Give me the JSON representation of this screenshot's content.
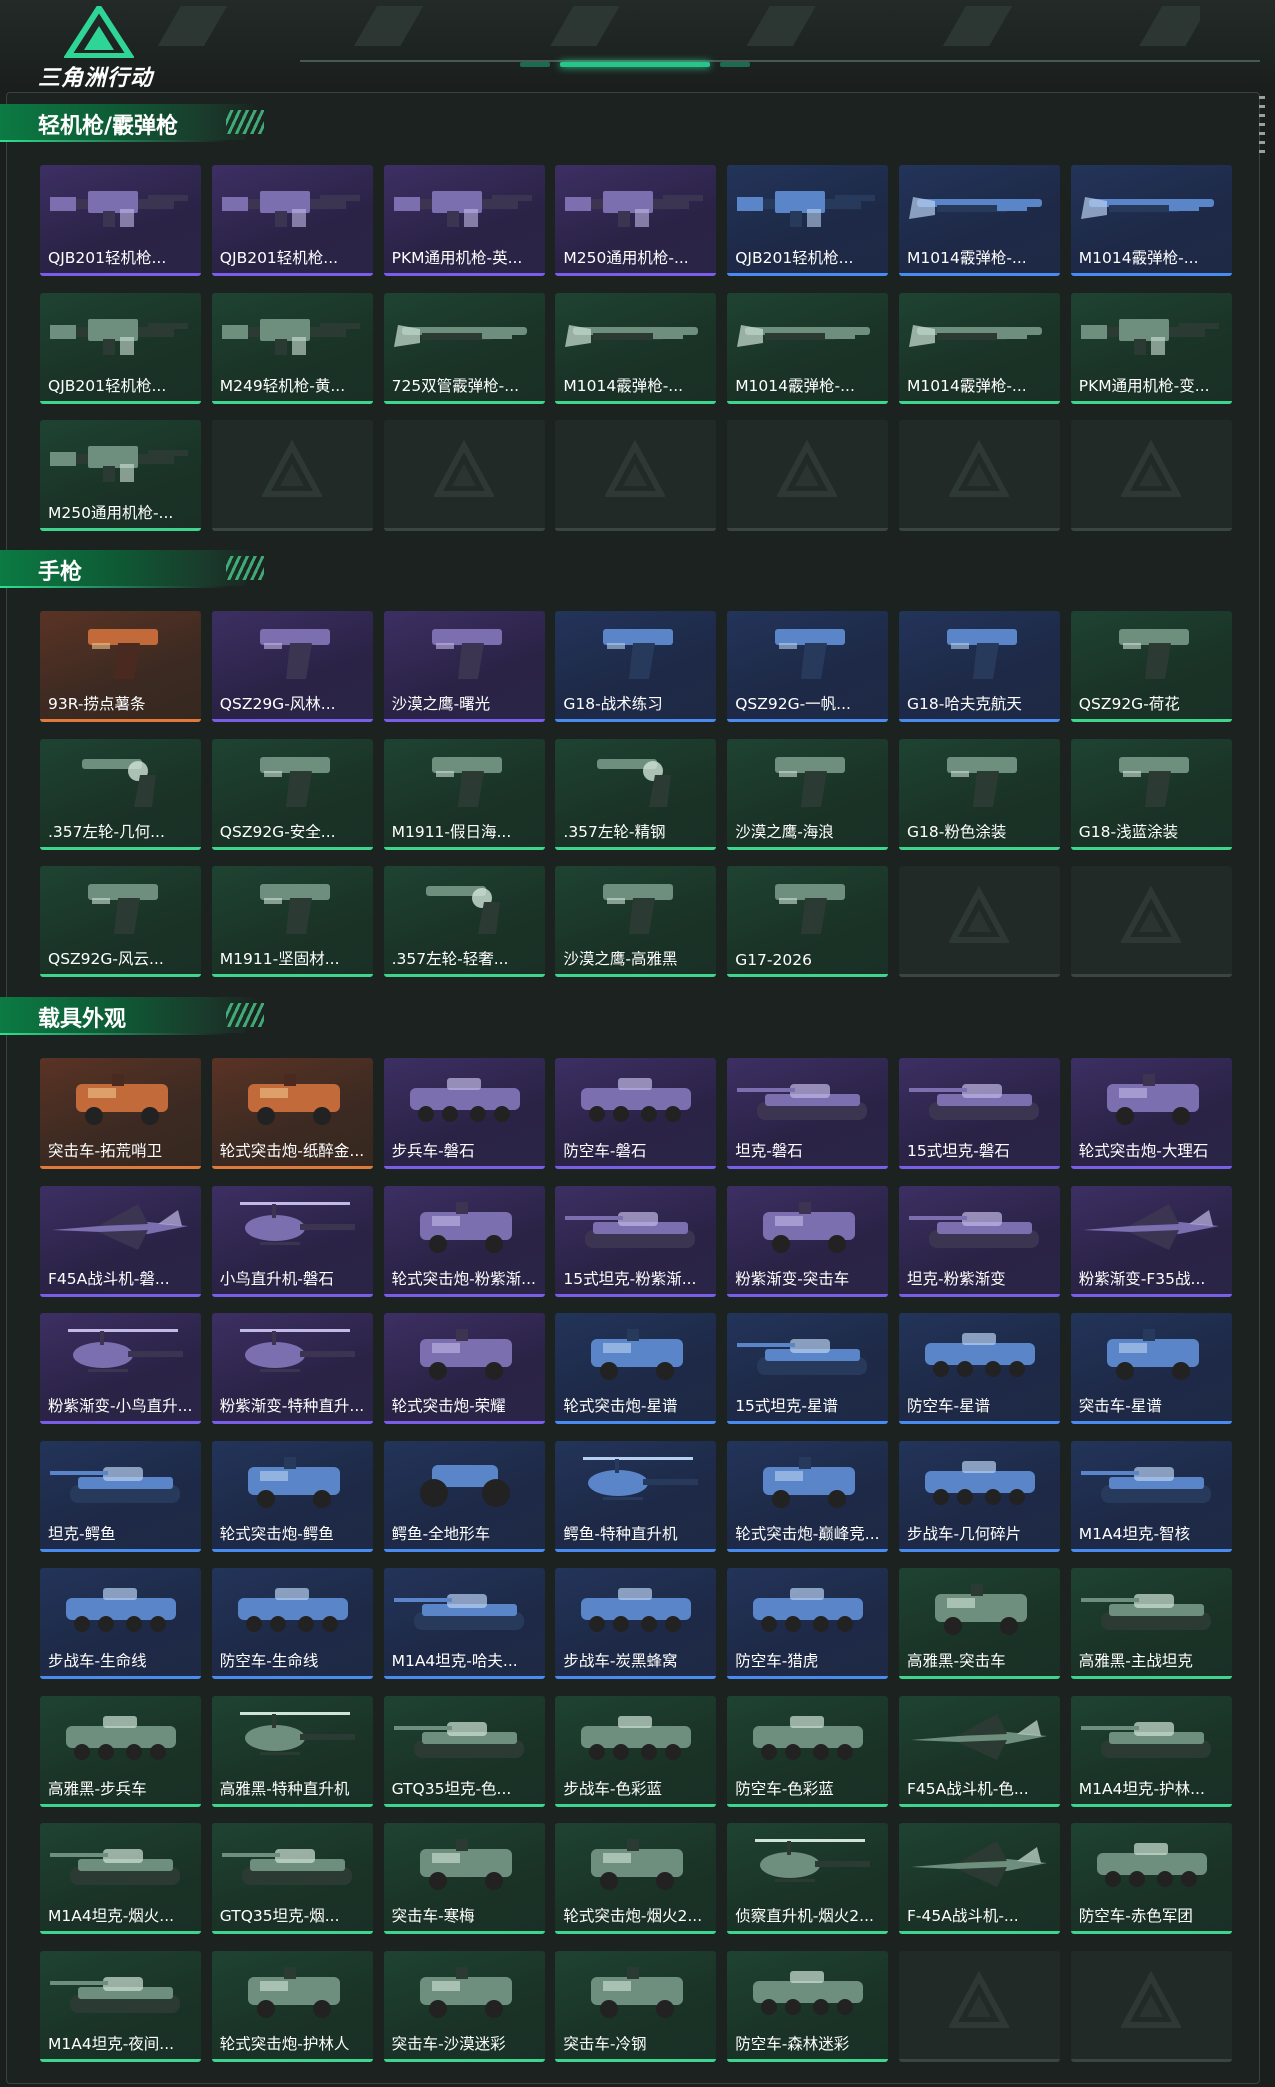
{
  "app": {
    "logo_text": "三角洲行动"
  },
  "sections": [
    {
      "title": "轻机枪/霰弹枪",
      "items": [
        {
          "label": "QJB201轻机枪...",
          "rarity": "purple",
          "icon": "machine-gun-icon"
        },
        {
          "label": "QJB201轻机枪...",
          "rarity": "purple",
          "icon": "machine-gun-icon"
        },
        {
          "label": "PKM通用机枪-英...",
          "rarity": "purple",
          "icon": "machine-gun-icon"
        },
        {
          "label": "M250通用机枪-...",
          "rarity": "purple",
          "icon": "machine-gun-icon"
        },
        {
          "label": "QJB201轻机枪...",
          "rarity": "blue",
          "icon": "machine-gun-icon"
        },
        {
          "label": "M1014霰弹枪-...",
          "rarity": "blue",
          "icon": "shotgun-icon"
        },
        {
          "label": "M1014霰弹枪-...",
          "rarity": "blue",
          "icon": "shotgun-icon"
        },
        {
          "label": "QJB201轻机枪...",
          "rarity": "green",
          "icon": "machine-gun-icon"
        },
        {
          "label": "M249轻机枪-黄...",
          "rarity": "green",
          "icon": "machine-gun-icon"
        },
        {
          "label": "725双管霰弹枪-...",
          "rarity": "green",
          "icon": "shotgun-icon"
        },
        {
          "label": "M1014霰弹枪-...",
          "rarity": "green",
          "icon": "shotgun-icon"
        },
        {
          "label": "M1014霰弹枪-...",
          "rarity": "green",
          "icon": "shotgun-icon"
        },
        {
          "label": "M1014霰弹枪-...",
          "rarity": "green",
          "icon": "shotgun-icon"
        },
        {
          "label": "PKM通用机枪-变...",
          "rarity": "green",
          "icon": "machine-gun-icon"
        },
        {
          "label": "M250通用机枪-...",
          "rarity": "green",
          "icon": "machine-gun-icon"
        },
        {
          "label": "",
          "rarity": "empty"
        },
        {
          "label": "",
          "rarity": "empty"
        },
        {
          "label": "",
          "rarity": "empty"
        },
        {
          "label": "",
          "rarity": "empty"
        },
        {
          "label": "",
          "rarity": "empty"
        },
        {
          "label": "",
          "rarity": "empty"
        }
      ]
    },
    {
      "title": "手枪",
      "items": [
        {
          "label": "93R-捞点薯条",
          "rarity": "orange",
          "icon": "pistol-icon"
        },
        {
          "label": "QSZ29G-风林...",
          "rarity": "purple",
          "icon": "pistol-icon"
        },
        {
          "label": "沙漠之鹰-曙光",
          "rarity": "purple",
          "icon": "pistol-icon"
        },
        {
          "label": "G18-战术练习",
          "rarity": "blue",
          "icon": "pistol-icon"
        },
        {
          "label": "QSZ92G-一帆...",
          "rarity": "blue",
          "icon": "pistol-icon"
        },
        {
          "label": "G18-哈夫克航天",
          "rarity": "blue",
          "icon": "pistol-icon"
        },
        {
          "label": "QSZ92G-荷花",
          "rarity": "green",
          "icon": "pistol-icon"
        },
        {
          "label": ".357左轮-几何...",
          "rarity": "green",
          "icon": "revolver-icon"
        },
        {
          "label": "QSZ92G-安全...",
          "rarity": "green",
          "icon": "pistol-icon"
        },
        {
          "label": "M1911-假日海...",
          "rarity": "green",
          "icon": "pistol-icon"
        },
        {
          "label": ".357左轮-精钢",
          "rarity": "green",
          "icon": "revolver-icon"
        },
        {
          "label": "沙漠之鹰-海浪",
          "rarity": "green",
          "icon": "pistol-icon"
        },
        {
          "label": "G18-粉色涂装",
          "rarity": "green",
          "icon": "pistol-icon"
        },
        {
          "label": "G18-浅蓝涂装",
          "rarity": "green",
          "icon": "pistol-icon"
        },
        {
          "label": "QSZ92G-风云...",
          "rarity": "green",
          "icon": "pistol-icon"
        },
        {
          "label": "M1911-坚固材...",
          "rarity": "green",
          "icon": "pistol-icon"
        },
        {
          "label": ".357左轮-轻奢...",
          "rarity": "green",
          "icon": "revolver-icon"
        },
        {
          "label": "沙漠之鹰-高雅黑",
          "rarity": "green",
          "icon": "pistol-icon"
        },
        {
          "label": "G17-2026",
          "rarity": "green",
          "icon": "pistol-icon"
        },
        {
          "label": "",
          "rarity": "empty"
        },
        {
          "label": "",
          "rarity": "empty"
        }
      ]
    },
    {
      "title": "载具外观",
      "items": [
        {
          "label": "突击车-拓荒哨卫",
          "rarity": "orange",
          "icon": "armored-car-icon"
        },
        {
          "label": "轮式突击炮-纸醉金...",
          "rarity": "orange",
          "icon": "armored-car-icon"
        },
        {
          "label": "步兵车-磐石",
          "rarity": "purple",
          "icon": "ifv-icon"
        },
        {
          "label": "防空车-磐石",
          "rarity": "purple",
          "icon": "ifv-icon"
        },
        {
          "label": "坦克-磐石",
          "rarity": "purple",
          "icon": "tank-icon"
        },
        {
          "label": "15式坦克-磐石",
          "rarity": "purple",
          "icon": "tank-icon"
        },
        {
          "label": "轮式突击炮-大理石",
          "rarity": "purple",
          "icon": "armored-car-icon"
        },
        {
          "label": "F45A战斗机-磐...",
          "rarity": "purple",
          "icon": "jet-icon"
        },
        {
          "label": "小鸟直升机-磐石",
          "rarity": "purple",
          "icon": "helicopter-icon"
        },
        {
          "label": "轮式突击炮-粉紫渐...",
          "rarity": "purple",
          "icon": "armored-car-icon"
        },
        {
          "label": "15式坦克-粉紫渐...",
          "rarity": "purple",
          "icon": "tank-icon"
        },
        {
          "label": "粉紫渐变-突击车",
          "rarity": "purple",
          "icon": "armored-car-icon"
        },
        {
          "label": "坦克-粉紫渐变",
          "rarity": "purple",
          "icon": "tank-icon"
        },
        {
          "label": "粉紫渐变-F35战...",
          "rarity": "purple",
          "icon": "jet-icon"
        },
        {
          "label": "粉紫渐变-小鸟直升...",
          "rarity": "purple",
          "icon": "helicopter-icon"
        },
        {
          "label": "粉紫渐变-特种直升...",
          "rarity": "purple",
          "icon": "helicopter-icon"
        },
        {
          "label": "轮式突击炮-荣耀",
          "rarity": "purple",
          "icon": "armored-car-icon"
        },
        {
          "label": "轮式突击炮-星谱",
          "rarity": "blue",
          "icon": "armored-car-icon"
        },
        {
          "label": "15式坦克-星谱",
          "rarity": "blue",
          "icon": "tank-icon"
        },
        {
          "label": "防空车-星谱",
          "rarity": "blue",
          "icon": "ifv-icon"
        },
        {
          "label": "突击车-星谱",
          "rarity": "blue",
          "icon": "armored-car-icon"
        },
        {
          "label": "坦克-鳄鱼",
          "rarity": "blue",
          "icon": "tank-icon"
        },
        {
          "label": "轮式突击炮-鳄鱼",
          "rarity": "blue",
          "icon": "armored-car-icon"
        },
        {
          "label": "鳄鱼-全地形车",
          "rarity": "blue",
          "icon": "atv-icon"
        },
        {
          "label": "鳄鱼-特种直升机",
          "rarity": "blue",
          "icon": "helicopter-icon"
        },
        {
          "label": "轮式突击炮-巅峰竞...",
          "rarity": "blue",
          "icon": "armored-car-icon"
        },
        {
          "label": "步战车-几何碎片",
          "rarity": "blue",
          "icon": "ifv-icon"
        },
        {
          "label": "M1A4坦克-智核",
          "rarity": "blue",
          "icon": "tank-icon"
        },
        {
          "label": "步战车-生命线",
          "rarity": "blue",
          "icon": "ifv-icon"
        },
        {
          "label": "防空车-生命线",
          "rarity": "blue",
          "icon": "ifv-icon"
        },
        {
          "label": "M1A4坦克-哈夫...",
          "rarity": "blue",
          "icon": "tank-icon"
        },
        {
          "label": "步战车-炭黑蜂窝",
          "rarity": "blue",
          "icon": "ifv-icon"
        },
        {
          "label": "防空车-猎虎",
          "rarity": "blue",
          "icon": "ifv-icon"
        },
        {
          "label": "高雅黑-突击车",
          "rarity": "green",
          "icon": "armored-car-icon"
        },
        {
          "label": "高雅黑-主战坦克",
          "rarity": "green",
          "icon": "tank-icon"
        },
        {
          "label": "高雅黑-步兵车",
          "rarity": "green",
          "icon": "ifv-icon"
        },
        {
          "label": "高雅黑-特种直升机",
          "rarity": "green",
          "icon": "helicopter-icon"
        },
        {
          "label": "GTQ35坦克-色...",
          "rarity": "green",
          "icon": "tank-icon"
        },
        {
          "label": "步战车-色彩蓝",
          "rarity": "green",
          "icon": "ifv-icon"
        },
        {
          "label": "防空车-色彩蓝",
          "rarity": "green",
          "icon": "ifv-icon"
        },
        {
          "label": "F45A战斗机-色...",
          "rarity": "green",
          "icon": "jet-icon"
        },
        {
          "label": "M1A4坦克-护林...",
          "rarity": "green",
          "icon": "tank-icon"
        },
        {
          "label": "M1A4坦克-烟火...",
          "rarity": "green",
          "icon": "tank-icon"
        },
        {
          "label": "GTQ35坦克-烟...",
          "rarity": "green",
          "icon": "tank-icon"
        },
        {
          "label": "突击车-寒梅",
          "rarity": "green",
          "icon": "armored-car-icon"
        },
        {
          "label": "轮式突击炮-烟火2...",
          "rarity": "green",
          "icon": "armored-car-icon"
        },
        {
          "label": "侦察直升机-烟火2...",
          "rarity": "green",
          "icon": "helicopter-icon"
        },
        {
          "label": "F-45A战斗机-...",
          "rarity": "green",
          "icon": "jet-icon"
        },
        {
          "label": "防空车-赤色军团",
          "rarity": "green",
          "icon": "ifv-icon"
        },
        {
          "label": "M1A4坦克-夜间...",
          "rarity": "green",
          "icon": "tank-icon"
        },
        {
          "label": "轮式突击炮-护林人",
          "rarity": "green",
          "icon": "armored-car-icon"
        },
        {
          "label": "突击车-沙漠迷彩",
          "rarity": "green",
          "icon": "armored-car-icon"
        },
        {
          "label": "突击车-冷钢",
          "rarity": "green",
          "icon": "armored-car-icon"
        },
        {
          "label": "防空车-森林迷彩",
          "rarity": "green",
          "icon": "ifv-icon"
        },
        {
          "label": "",
          "rarity": "empty"
        },
        {
          "label": "",
          "rarity": "empty"
        }
      ]
    }
  ]
}
